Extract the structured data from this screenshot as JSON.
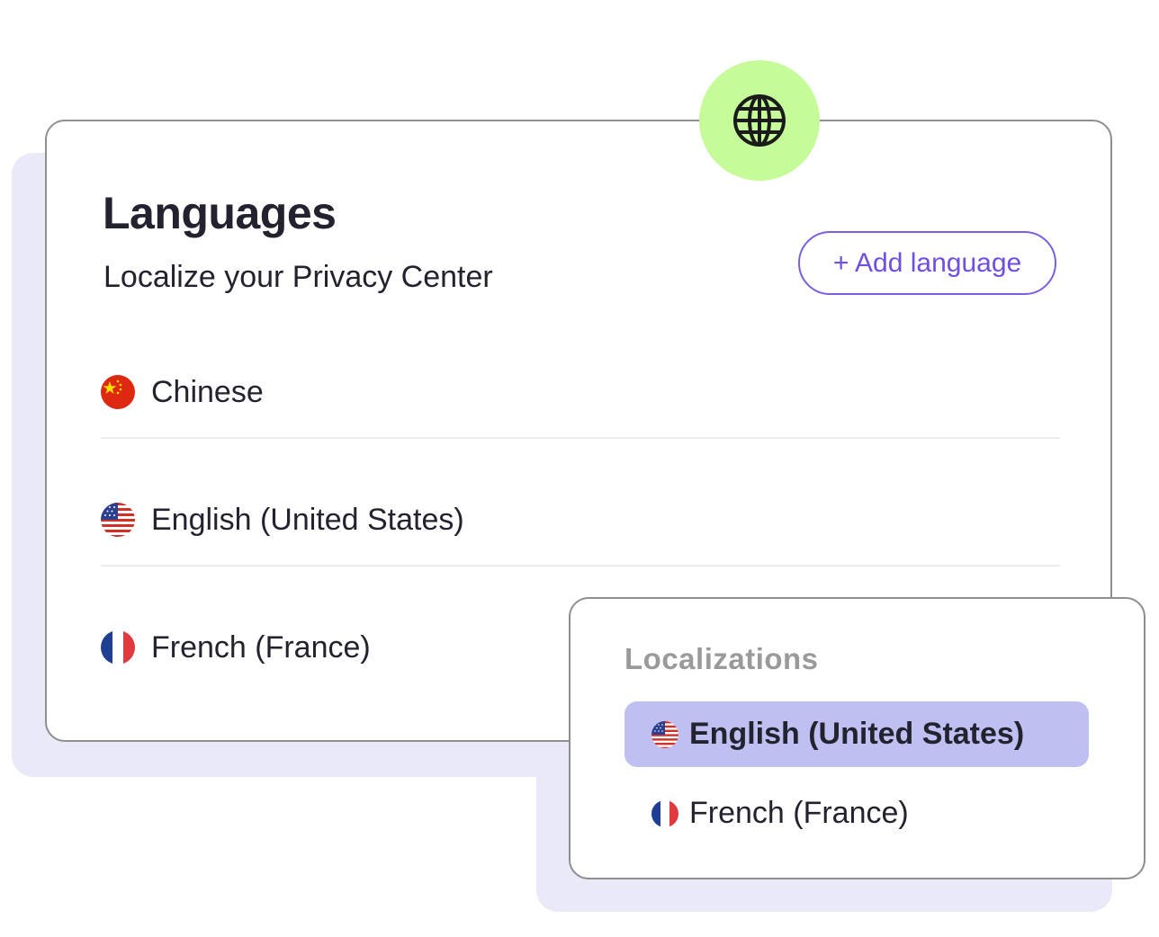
{
  "languages_card": {
    "title": "Languages",
    "subtitle": "Localize your Privacy Center",
    "add_button_label": "+ Add language",
    "items": [
      {
        "label": "Chinese",
        "flag": "china-flag-icon"
      },
      {
        "label": "English (United States)",
        "flag": "us-flag-icon"
      },
      {
        "label": "French (France)",
        "flag": "france-flag-icon"
      }
    ]
  },
  "badge": {
    "icon": "globe-icon",
    "color": "#c6fb9a"
  },
  "localizations_popup": {
    "title": "Localizations",
    "items": [
      {
        "label": "English (United States)",
        "flag": "us-flag-icon",
        "selected": true
      },
      {
        "label": "French (France)",
        "flag": "france-flag-icon",
        "selected": false
      }
    ]
  },
  "colors": {
    "accent": "#6f4ee0",
    "selected_bg": "#bfbff2",
    "shadow": "#eae9f7",
    "text": "#23232f"
  }
}
